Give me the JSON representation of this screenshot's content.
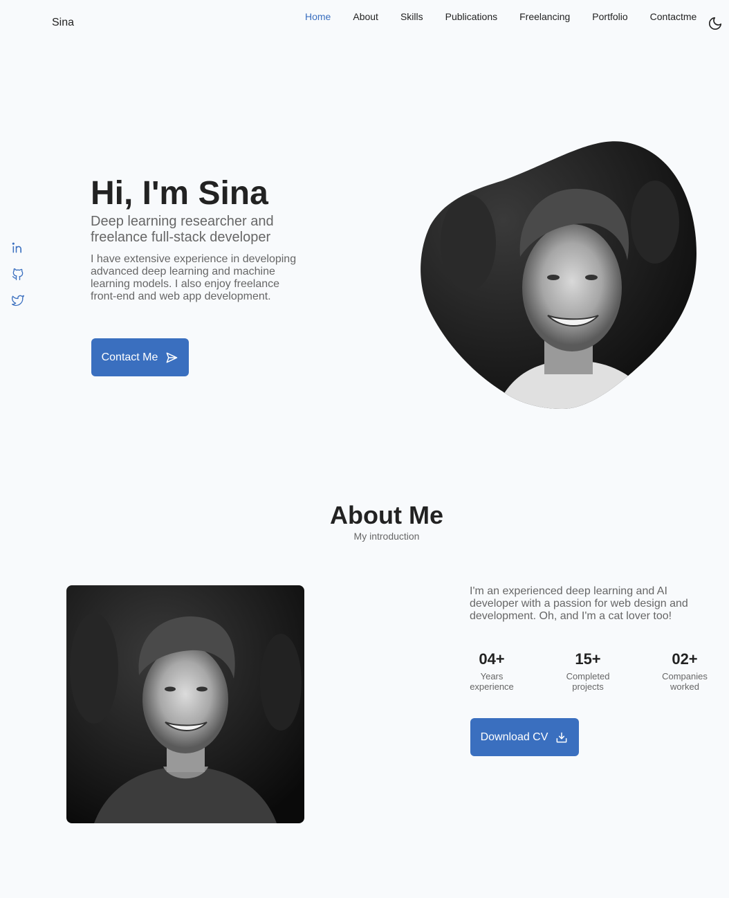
{
  "header": {
    "logo": "Sina",
    "nav": [
      "Home",
      "About",
      "Skills",
      "Publications",
      "Freelancing",
      "Portfolio",
      "Contactme"
    ],
    "active": "Home",
    "theme_icon": "moon-icon"
  },
  "social": [
    "linkedin-icon",
    "github-icon",
    "twitter-icon"
  ],
  "hero": {
    "title": "Hi, I'm Sina",
    "subtitle": "Deep learning researcher and freelance full-stack developer",
    "description": "I have extensive experience in developing advanced deep learning and machine learning models. I also enjoy freelance front-end and web app development.",
    "button_label": "Contact Me",
    "button_icon": "send-icon"
  },
  "about": {
    "title": "About Me",
    "subtitle": "My introduction",
    "description": "I'm an experienced deep learning and AI developer with a passion for web design and development. Oh, and I'm a cat lover too!",
    "stats": [
      {
        "number": "04+",
        "label": "Years experience"
      },
      {
        "number": "15+",
        "label": "Completed projects"
      },
      {
        "number": "02+",
        "label": "Companies worked"
      }
    ],
    "button_label": "Download CV",
    "button_icon": "download-icon"
  },
  "colors": {
    "accent": "#3a6fbf",
    "background": "#f8fafc",
    "text": "#222222",
    "muted": "#666666"
  }
}
